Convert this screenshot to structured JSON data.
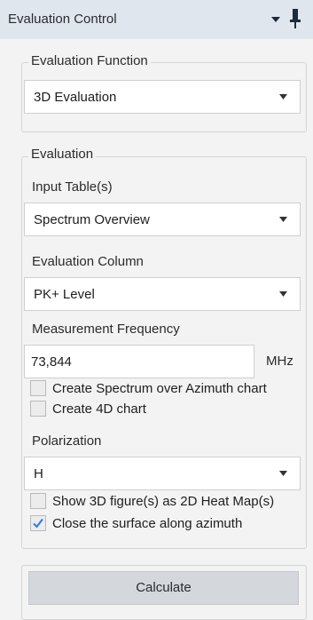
{
  "window": {
    "title": "Evaluation Control",
    "dropdown_icon": "triangle-down-icon",
    "pin_icon": "pushpin-icon"
  },
  "evaluation_function": {
    "legend": "Evaluation Function",
    "selected": "3D Evaluation"
  },
  "evaluation": {
    "legend": "Evaluation",
    "input_tables": {
      "label": "Input Table(s)",
      "selected": "Spectrum Overview"
    },
    "evaluation_column": {
      "label": "Evaluation Column",
      "selected": "PK+ Level"
    },
    "measurement_frequency": {
      "label": "Measurement Frequency",
      "value": "73,844",
      "unit": "MHz"
    },
    "checkboxes_1": [
      {
        "label": "Create Spectrum over Azimuth chart",
        "checked": false
      },
      {
        "label": "Create 4D chart",
        "checked": false
      }
    ],
    "polarization": {
      "label": "Polarization",
      "selected": "H"
    },
    "checkboxes_2": [
      {
        "label": "Show 3D figure(s) as 2D Heat Map(s)",
        "checked": false
      },
      {
        "label": "Close the surface along azimuth",
        "checked": true
      }
    ]
  },
  "actions": {
    "calculate_label": "Calculate"
  },
  "colors": {
    "check_accent": "#2a7ae2",
    "titlebar_bg": "#dfe6ee",
    "button_bg": "#d4d8dc"
  }
}
